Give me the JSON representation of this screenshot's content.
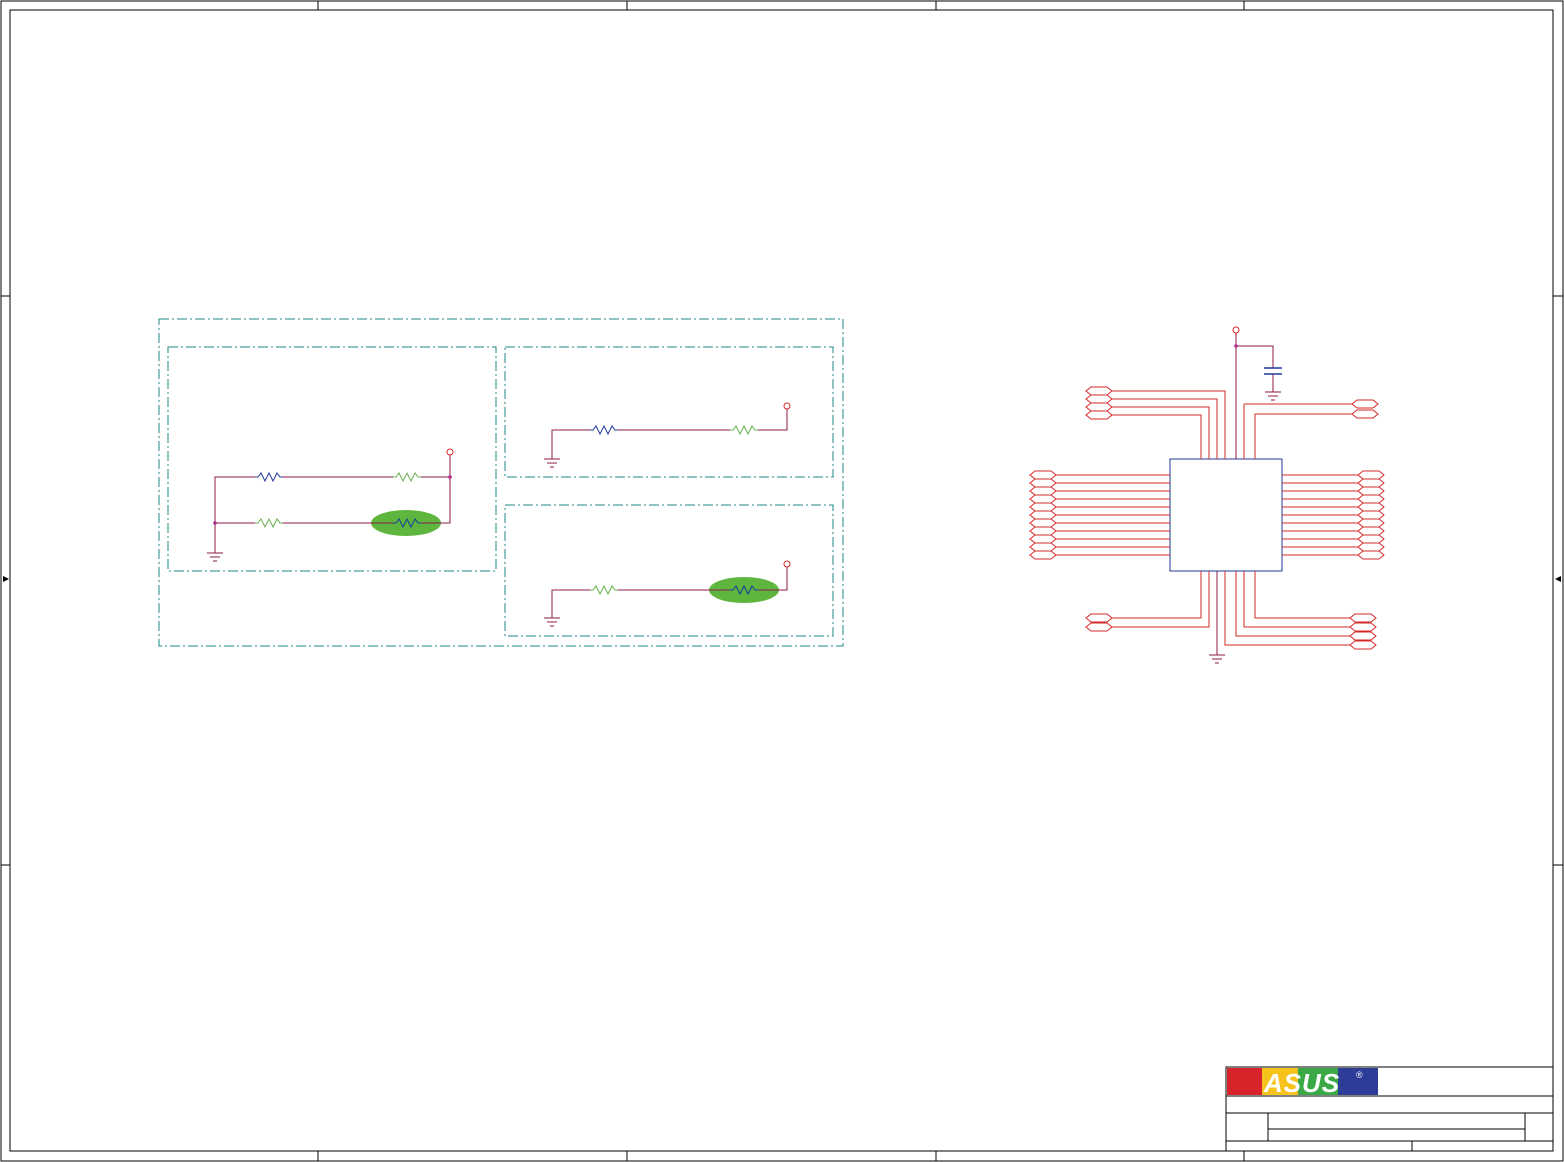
{
  "title_block": {
    "logo_text": "ASUS",
    "logo_registered": "®"
  },
  "colors": {
    "frame": "#000000",
    "group_border": "#1a8a8a",
    "wire": "#8b1a4a",
    "pin": "#d42a2a",
    "resistor_blue": "#1f3a9a",
    "resistor_green": "#6ab04c",
    "highlight": "#5fb63e",
    "chip": "#1f3a9a"
  }
}
